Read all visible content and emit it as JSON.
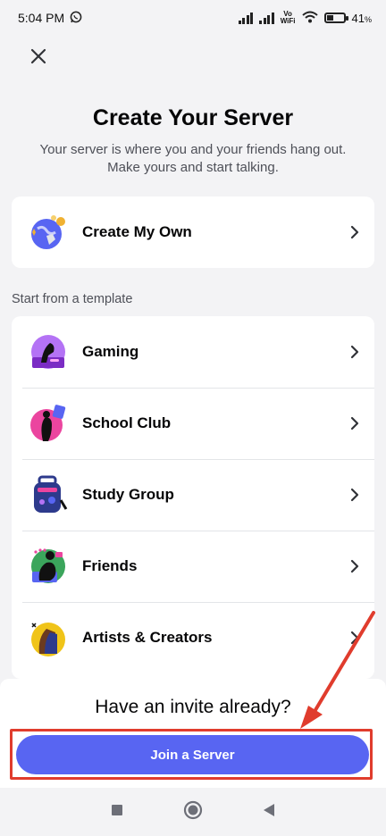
{
  "status_bar": {
    "time": "5:04 PM",
    "vo_label": "Vo",
    "wifi_label": "WiFi",
    "battery_percent": "41",
    "battery_symbol": "%",
    "battery_level": 0.41
  },
  "header": {
    "close_icon": "close-icon",
    "title": "Create Your Server",
    "subtitle_line1": "Your server is where you and your friends hang out.",
    "subtitle_line2": "Make yours and start talking."
  },
  "create_own": {
    "label": "Create My Own",
    "icon": "globe-sparkle-icon"
  },
  "templates": {
    "section_label": "Start from a template",
    "items": [
      {
        "label": "Gaming",
        "icon": "gaming-icon"
      },
      {
        "label": "School Club",
        "icon": "school-club-icon"
      },
      {
        "label": "Study Group",
        "icon": "study-group-icon"
      },
      {
        "label": "Friends",
        "icon": "friends-icon"
      },
      {
        "label": "Artists & Creators",
        "icon": "artists-icon"
      }
    ]
  },
  "invite": {
    "title": "Have an invite already?",
    "button_label": "Join a Server"
  },
  "colors": {
    "accent": "#5865f2",
    "annotation": "#e03c2d",
    "background": "#f3f3f5"
  }
}
